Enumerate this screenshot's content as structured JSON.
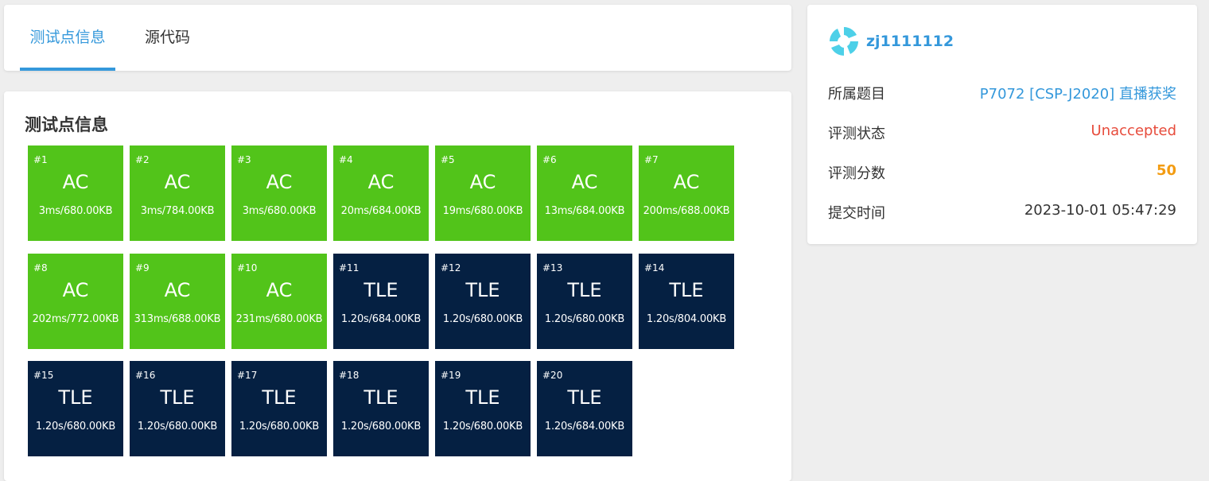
{
  "tabs": [
    {
      "label": "测试点信息",
      "active": true
    },
    {
      "label": "源代码",
      "active": false
    }
  ],
  "section_title": "测试点信息",
  "testcases": [
    {
      "id": "#1",
      "status": "AC",
      "info": "3ms/680.00KB"
    },
    {
      "id": "#2",
      "status": "AC",
      "info": "3ms/784.00KB"
    },
    {
      "id": "#3",
      "status": "AC",
      "info": "3ms/680.00KB"
    },
    {
      "id": "#4",
      "status": "AC",
      "info": "20ms/684.00KB"
    },
    {
      "id": "#5",
      "status": "AC",
      "info": "19ms/680.00KB"
    },
    {
      "id": "#6",
      "status": "AC",
      "info": "13ms/684.00KB"
    },
    {
      "id": "#7",
      "status": "AC",
      "info": "200ms/688.00KB"
    },
    {
      "id": "#8",
      "status": "AC",
      "info": "202ms/772.00KB"
    },
    {
      "id": "#9",
      "status": "AC",
      "info": "313ms/688.00KB"
    },
    {
      "id": "#10",
      "status": "AC",
      "info": "231ms/680.00KB"
    },
    {
      "id": "#11",
      "status": "TLE",
      "info": "1.20s/684.00KB"
    },
    {
      "id": "#12",
      "status": "TLE",
      "info": "1.20s/680.00KB"
    },
    {
      "id": "#13",
      "status": "TLE",
      "info": "1.20s/680.00KB"
    },
    {
      "id": "#14",
      "status": "TLE",
      "info": "1.20s/804.00KB"
    },
    {
      "id": "#15",
      "status": "TLE",
      "info": "1.20s/680.00KB"
    },
    {
      "id": "#16",
      "status": "TLE",
      "info": "1.20s/680.00KB"
    },
    {
      "id": "#17",
      "status": "TLE",
      "info": "1.20s/680.00KB"
    },
    {
      "id": "#18",
      "status": "TLE",
      "info": "1.20s/680.00KB"
    },
    {
      "id": "#19",
      "status": "TLE",
      "info": "1.20s/680.00KB"
    },
    {
      "id": "#20",
      "status": "TLE",
      "info": "1.20s/684.00KB"
    }
  ],
  "user": {
    "name": "zj1111112",
    "avatar_icon": "user-avatar-icon"
  },
  "details": {
    "problem_label": "所属题目",
    "problem_value": "P7072 [CSP-J2020] 直播获奖",
    "status_label": "评测状态",
    "status_value": "Unaccepted",
    "score_label": "评测分数",
    "score_value": "50",
    "time_label": "提交时间",
    "time_value": "2023-10-01 05:47:29"
  },
  "colors": {
    "accent": "#3498db",
    "ac": "#52c41a",
    "tle": "#052042",
    "unaccepted": "#e74c3c",
    "score": "#f39c12"
  }
}
